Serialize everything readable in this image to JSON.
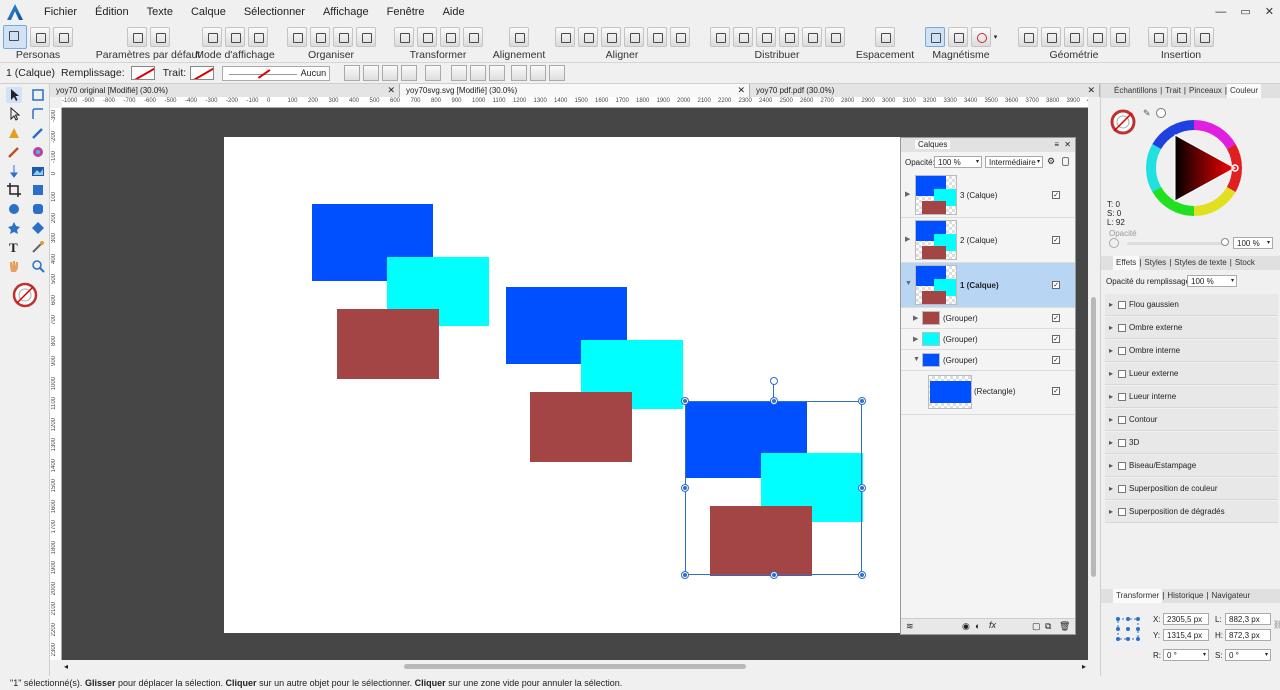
{
  "menu": [
    "Fichier",
    "Édition",
    "Texte",
    "Calque",
    "Sélectionner",
    "Affichage",
    "Fenêtre",
    "Aide"
  ],
  "window_controls": [
    "—",
    "▭",
    "✕"
  ],
  "toolbar": {
    "personas": "Personas",
    "defaults": "Paramètres par défaut",
    "view_mode": "Mode d'affichage",
    "arrange": "Organiser",
    "transform": "Transformer",
    "alignment": "Alignement",
    "align": "Aligner",
    "distribute": "Distribuer",
    "spacing": "Espacement",
    "snapping": "Magnétisme",
    "geometry": "Géométrie",
    "insert": "Insertion"
  },
  "context": {
    "selection": "1 (Calque)",
    "fill_label": "Remplissage:",
    "stroke_label": "Trait:",
    "stroke_value": "Aucun"
  },
  "doc_tabs": [
    {
      "title": "yoy70 original [Modifié] (30.0%)",
      "close": "✕"
    },
    {
      "title": "yoy70svg.svg [Modifié] (30.0%)",
      "close": "✕"
    },
    {
      "title": "yoy70 pdf.pdf (30.0%)",
      "close": "✕"
    }
  ],
  "ruler_h": [
    "-1000",
    "-900",
    "-800",
    "-700",
    "-600",
    "-500",
    "-400",
    "-300",
    "-200",
    "-100",
    "0",
    "100",
    "200",
    "300",
    "400",
    "500",
    "600",
    "700",
    "800",
    "900",
    "1000",
    "1100",
    "1200",
    "1300",
    "1400",
    "1500",
    "1600",
    "1700",
    "1800",
    "1900",
    "2000",
    "2100",
    "2200",
    "2300",
    "2400",
    "2500",
    "2600",
    "2700",
    "2800",
    "2900",
    "3000",
    "3100",
    "3200",
    "3300",
    "3400",
    "3500",
    "3600",
    "3700",
    "3800",
    "3900",
    "4000"
  ],
  "ruler_v": [
    "-300",
    "-200",
    "-100",
    "0",
    "100",
    "200",
    "300",
    "400",
    "500",
    "600",
    "700",
    "800",
    "900",
    "1000",
    "1100",
    "1200",
    "1300",
    "1400",
    "1500",
    "1600",
    "1700",
    "1800",
    "1900",
    "2000",
    "2100",
    "2200",
    "2300"
  ],
  "colors": {
    "blue": "#0050ff",
    "cyan": "#00ffff",
    "brown": "#a34545",
    "selection": "#2f6fc8"
  },
  "layers": {
    "title": "Calques",
    "opacity_label": "Opacité:",
    "opacity_value": "100 %",
    "blend_mode": "Intermédiaire",
    "rows": [
      {
        "label": "3 (Calque)",
        "check": "✓"
      },
      {
        "label": "2 (Calque)",
        "check": "✓"
      },
      {
        "label": "1 (Calque)",
        "check": "✓"
      },
      {
        "label": "(Grouper)",
        "check": "✓"
      },
      {
        "label": "(Grouper)",
        "check": "✓"
      },
      {
        "label": "(Grouper)",
        "check": "✓"
      },
      {
        "label": "(Rectangle)",
        "check": "✓"
      }
    ]
  },
  "color_panel": {
    "tabs": [
      "Échantillons",
      "Trait",
      "Pinceaux",
      "Couleur"
    ],
    "t": "T: 0",
    "s": "S: 0",
    "l": "L: 92",
    "opacity_label": "Opacité",
    "opacity_value": "100 %"
  },
  "effects_panel": {
    "tabs": [
      "Effets",
      "Styles",
      "Styles de texte",
      "Stock"
    ],
    "fill_opacity_label": "Opacité du remplissage:",
    "fill_opacity_value": "100 %",
    "effects": [
      "Flou gaussien",
      "Ombre externe",
      "Ombre interne",
      "Lueur externe",
      "Lueur interne",
      "Contour",
      "3D",
      "Biseau/Estampage",
      "Superposition de couleur",
      "Superposition de dégradés"
    ]
  },
  "transform_panel": {
    "tabs": [
      "Transformer",
      "Historique",
      "Navigateur"
    ],
    "x_label": "X:",
    "x": "2305,5 px",
    "y_label": "Y:",
    "y": "1315,4 px",
    "w_label": "L:",
    "w": "882,3 px",
    "h_label": "H:",
    "h": "872,3 px",
    "r_label": "R:",
    "r": "0 °",
    "s_label": "S:",
    "s": "0 °"
  },
  "status": {
    "count": "\"1\" sélectionné(s).",
    "b1": "Glisser",
    "t1": " pour déplacer la sélection. ",
    "b2": "Cliquer",
    "t2": " sur un autre objet pour le sélectionner. ",
    "b3": "Cliquer",
    "t3": " sur une zone vide pour annuler la sélection."
  }
}
